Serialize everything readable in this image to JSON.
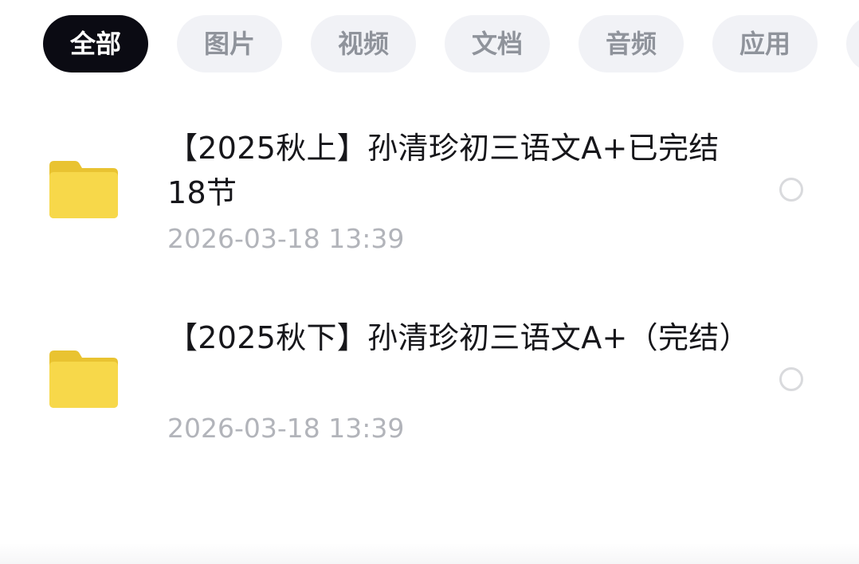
{
  "filter_tabs": [
    {
      "label": "全部",
      "active": true
    },
    {
      "label": "图片",
      "active": false
    },
    {
      "label": "视频",
      "active": false
    },
    {
      "label": "文档",
      "active": false
    },
    {
      "label": "音频",
      "active": false
    },
    {
      "label": "应用",
      "active": false
    }
  ],
  "files": [
    {
      "name": "【2025秋上】孙清珍初三语文A+已完结18节",
      "date": "2026-03-18  13:39",
      "icon": "folder-icon",
      "selected": false
    },
    {
      "name": "【2025秋下】孙清珍初三语文A+（完结）",
      "date": "2026-03-18  13:39",
      "icon": "folder-icon",
      "selected": false
    }
  ],
  "colors": {
    "active_tab_bg": "#0b0b13",
    "inactive_tab_bg": "#f1f2f6",
    "folder_yellow": "#f7d84a"
  }
}
